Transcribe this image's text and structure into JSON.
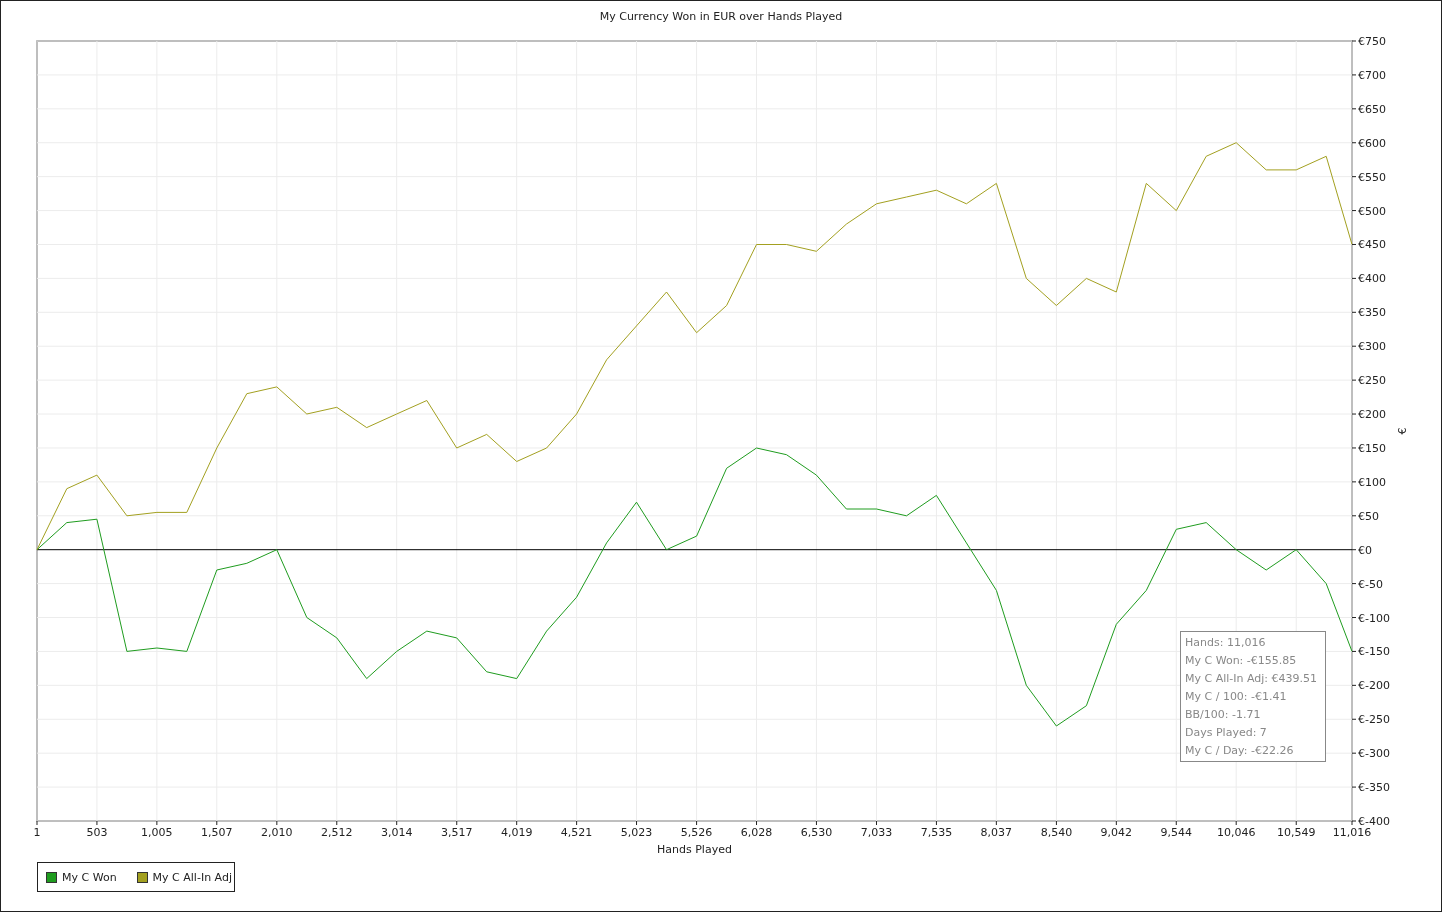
{
  "chart": {
    "chart_data": {
      "type": "line",
      "title": "My Currency Won in EUR over Hands Played",
      "xlabel": "Hands Played",
      "ylabel": "€",
      "x": [
        1,
        251,
        503,
        754,
        1005,
        1256,
        1507,
        1758,
        2010,
        2261,
        2512,
        2763,
        3014,
        3266,
        3517,
        3768,
        4019,
        4270,
        4521,
        4772,
        5023,
        5274,
        5526,
        5777,
        6028,
        6279,
        6530,
        6781,
        7033,
        7284,
        7535,
        7786,
        8037,
        8288,
        8540,
        8791,
        9042,
        9293,
        9544,
        9795,
        10046,
        10297,
        10549,
        10800,
        11016
      ],
      "series": [
        {
          "name": "My C Won",
          "color": "#1f9c1f",
          "values": [
            0,
            40,
            45,
            -150,
            -145,
            -150,
            -30,
            -20,
            0,
            -100,
            -130,
            -190,
            -150,
            -120,
            -130,
            -180,
            -190,
            -120,
            -70,
            10,
            70,
            0,
            20,
            120,
            150,
            140,
            110,
            60,
            60,
            50,
            80,
            10,
            -60,
            -200,
            -260,
            -230,
            -110,
            -60,
            30,
            40,
            0,
            -30,
            0,
            -50,
            -150
          ]
        },
        {
          "name": "My C All-In Adj",
          "color": "#a3a020",
          "values": [
            0,
            90,
            110,
            50,
            55,
            55,
            150,
            230,
            240,
            200,
            210,
            180,
            200,
            220,
            150,
            170,
            130,
            150,
            200,
            280,
            330,
            380,
            320,
            360,
            450,
            450,
            440,
            480,
            510,
            520,
            530,
            510,
            540,
            400,
            360,
            400,
            380,
            540,
            500,
            580,
            600,
            560,
            560,
            580,
            450
          ]
        }
      ],
      "grid": true,
      "xlim": [
        1,
        11016
      ],
      "ylim": [
        -400,
        750
      ],
      "xticks": [
        1,
        {
          "value": 503,
          "label": "503"
        },
        {
          "value": 1005,
          "label": "1,005"
        },
        {
          "value": 1507,
          "label": "1,507"
        },
        {
          "value": 2010,
          "label": "2,010"
        },
        {
          "value": 2512,
          "label": "2,512"
        },
        {
          "value": 3014,
          "label": "3,014"
        },
        {
          "value": 3517,
          "label": "3,517"
        },
        {
          "value": 4019,
          "label": "4,019"
        },
        {
          "value": 4521,
          "label": "4,521"
        },
        {
          "value": 5023,
          "label": "5,023"
        },
        {
          "value": 5526,
          "label": "5,526"
        },
        {
          "value": 6028,
          "label": "6,028"
        },
        {
          "value": 6530,
          "label": "6,530"
        },
        {
          "value": 7033,
          "label": "7,033"
        },
        {
          "value": 7535,
          "label": "7,535"
        },
        {
          "value": 8037,
          "label": "8,037"
        },
        {
          "value": 8540,
          "label": "8,540"
        },
        {
          "value": 9042,
          "label": "9,042"
        },
        {
          "value": 9544,
          "label": "9,544"
        },
        {
          "value": 10046,
          "label": "10,046"
        },
        {
          "value": 10549,
          "label": "10,549"
        },
        {
          "value": 11016,
          "label": "11,016"
        }
      ],
      "yticks": [
        {
          "value": 750,
          "label": "€750"
        },
        {
          "value": 700,
          "label": "€700"
        },
        {
          "value": 650,
          "label": "€650"
        },
        {
          "value": 600,
          "label": "€600"
        },
        {
          "value": 550,
          "label": "€550"
        },
        {
          "value": 500,
          "label": "€500"
        },
        {
          "value": 450,
          "label": "€450"
        },
        {
          "value": 400,
          "label": "€400"
        },
        {
          "value": 350,
          "label": "€350"
        },
        {
          "value": 300,
          "label": "€300"
        },
        {
          "value": 250,
          "label": "€250"
        },
        {
          "value": 200,
          "label": "€200"
        },
        {
          "value": 150,
          "label": "€150"
        },
        {
          "value": 100,
          "label": "€100"
        },
        {
          "value": 50,
          "label": "€50"
        },
        {
          "value": 0,
          "label": "€0"
        },
        {
          "value": -50,
          "label": "€-50"
        },
        {
          "value": -100,
          "label": "€-100"
        },
        {
          "value": -150,
          "label": "€-150"
        },
        {
          "value": -200,
          "label": "€-200"
        },
        {
          "value": -250,
          "label": "€-250"
        },
        {
          "value": -300,
          "label": "€-300"
        },
        {
          "value": -350,
          "label": "€-350"
        },
        {
          "value": -400,
          "label": "€-400"
        }
      ]
    },
    "tooltip": [
      "Hands: 11,016",
      "My C Won: -€155.85",
      "My C All-In Adj: €439.51",
      "My C / 100: -€1.41",
      "BB/100: -1.71",
      "Days Played: 7",
      "My C / Day: -€22.26"
    ]
  }
}
